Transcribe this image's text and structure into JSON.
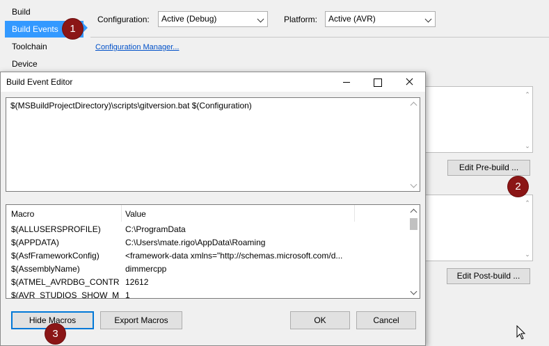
{
  "nav": {
    "items": [
      {
        "label": "Build",
        "active": false
      },
      {
        "label": "Build Events",
        "active": true
      },
      {
        "label": "Toolchain",
        "active": false
      },
      {
        "label": "Device",
        "active": false
      }
    ]
  },
  "header": {
    "configuration_label": "Configuration:",
    "configuration_value": "Active (Debug)",
    "platform_label": "Platform:",
    "platform_value": "Active (AVR)",
    "config_manager_link": "Configuration Manager..."
  },
  "buttons": {
    "edit_prebuild": "Edit Pre-build ...",
    "edit_postbuild": "Edit Post-build ..."
  },
  "badges": [
    "1",
    "2",
    "3"
  ],
  "dialog": {
    "title": "Build Event Editor",
    "command_text": "$(MSBuildProjectDirectory)\\scripts\\gitversion.bat $(Configuration)",
    "columns": {
      "macro": "Macro",
      "value": "Value"
    },
    "rows": [
      {
        "macro": "$(ALLUSERSPROFILE)",
        "value": "C:\\ProgramData"
      },
      {
        "macro": "$(APPDATA)",
        "value": "C:\\Users\\mate.rigo\\AppData\\Roaming"
      },
      {
        "macro": "$(AsfFrameworkConfig)",
        "value": "<framework-data xmlns=\"http://schemas.microsoft.com/d..."
      },
      {
        "macro": "$(AssemblyName)",
        "value": "dimmercpp"
      },
      {
        "macro": "$(ATMEL_AVRDBG_CONTR...",
        "value": "12612"
      },
      {
        "macro": "$(AVR_STUDIOS_SHOW_MO...",
        "value": "1"
      }
    ],
    "hide_macros": "Hide Macros",
    "export_macros": "Export Macros",
    "ok": "OK",
    "cancel": "Cancel"
  },
  "colors": {
    "accent": "#3399ff",
    "badge": "#8b1616",
    "link": "#0050c8",
    "default_button_border": "#0078d7"
  }
}
